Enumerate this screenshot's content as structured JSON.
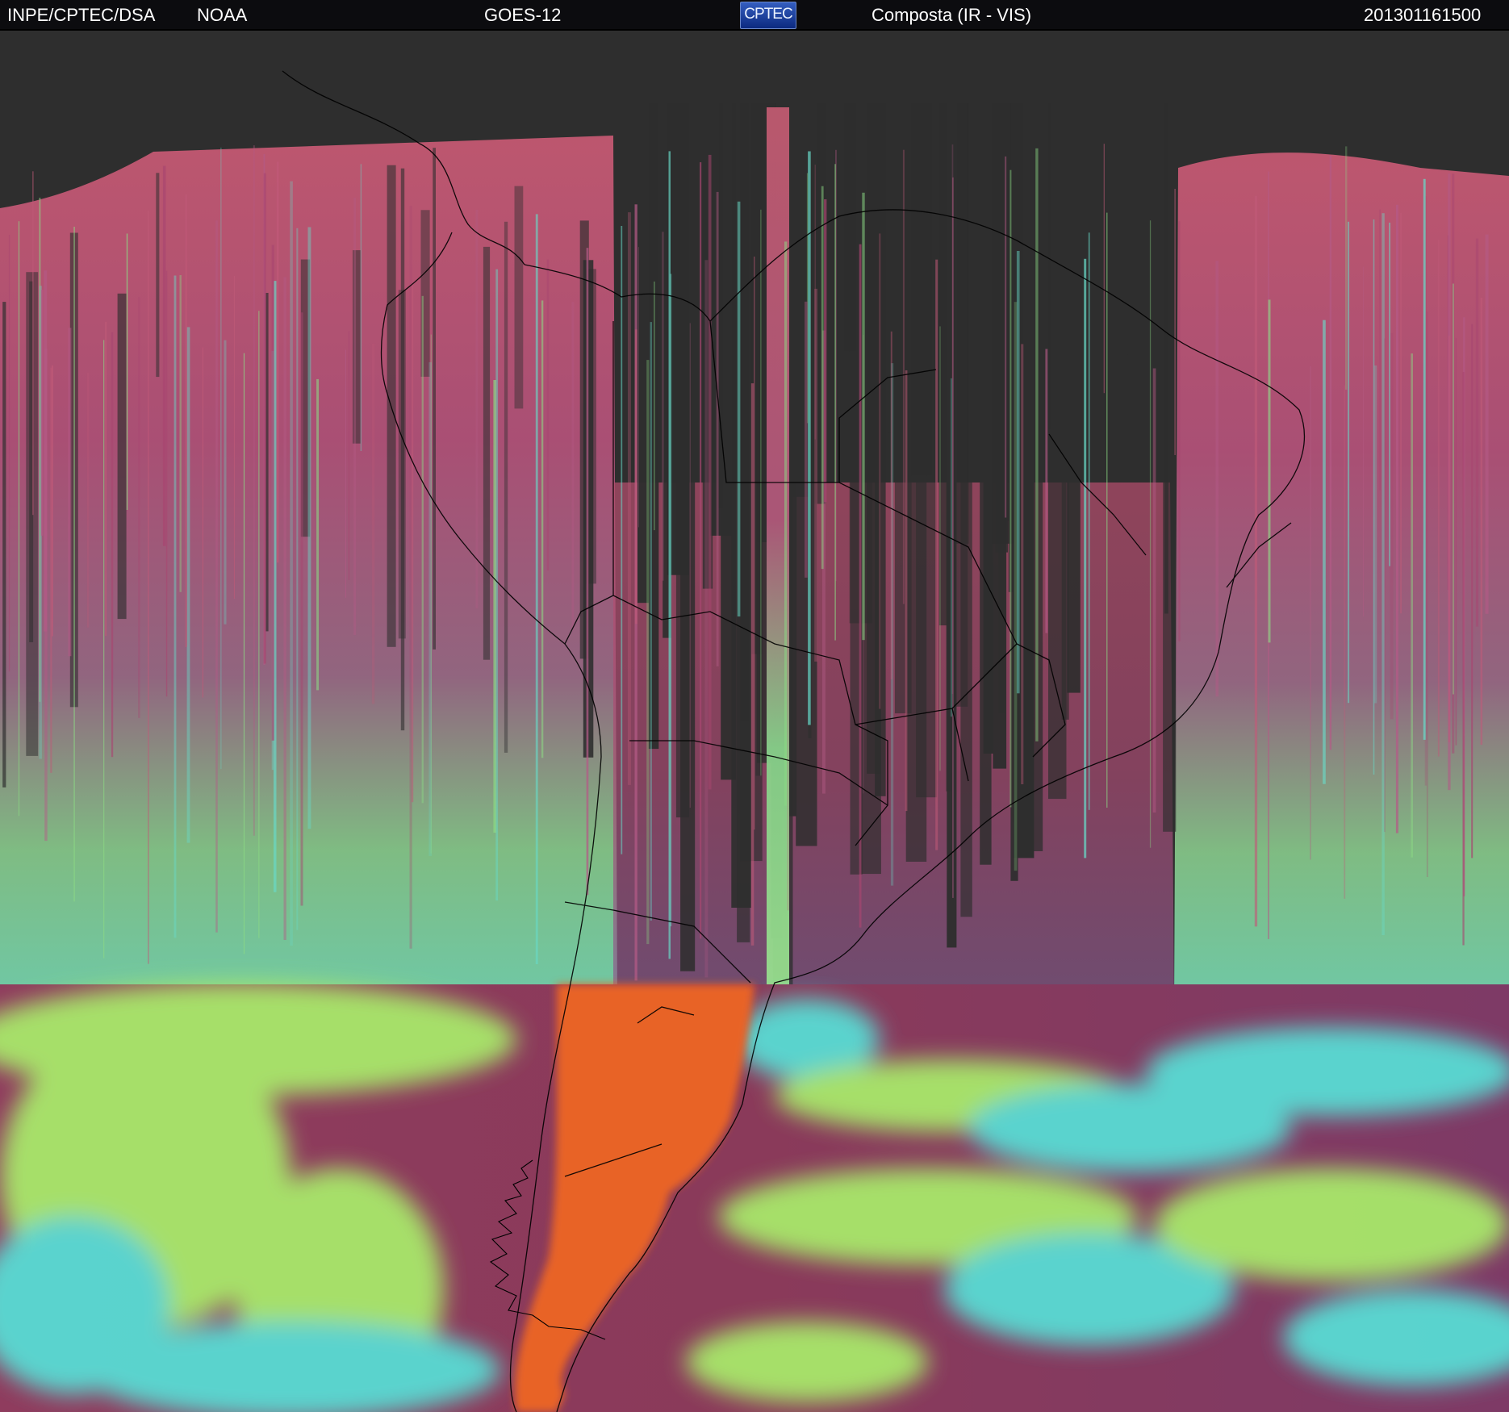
{
  "header": {
    "agency": "INPE/CPTEC/DSA",
    "partner": "NOAA",
    "satellite": "GOES-12",
    "logo_text": "CPTEC",
    "product": "Composta (IR - VIS)",
    "timestamp": "201301161500"
  },
  "imagery": {
    "palette": {
      "background": "#2e2e2e",
      "stripe_magenta": "#c05a78",
      "stripe_pink": "#a84670",
      "stripe_green": "#8cda84",
      "stripe_cyan": "#68dac8",
      "ocean_magenta": "#8a3a5a",
      "land_orange": "#e86428",
      "cloud_green": "#a8e86a",
      "cloud_cyan": "#58dcd4",
      "boundary_line": "#000000"
    }
  }
}
